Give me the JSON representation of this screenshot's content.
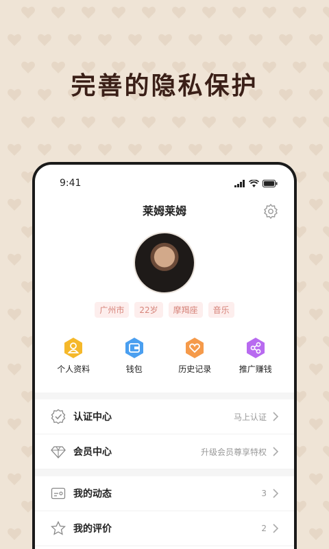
{
  "promo_title": "完善的隐私保护",
  "status_bar": {
    "time": "9:41"
  },
  "profile": {
    "name": "莱姆莱姆",
    "tags": [
      "广州市",
      "22岁",
      "摩羯座",
      "音乐"
    ]
  },
  "quick_actions": [
    {
      "label": "个人资料",
      "icon": "profile-icon",
      "color": "#f5b82a"
    },
    {
      "label": "钱包",
      "icon": "wallet-icon",
      "color": "#4a9ff0"
    },
    {
      "label": "历史记录",
      "icon": "history-icon",
      "color": "#f59a4a"
    },
    {
      "label": "推广赚钱",
      "icon": "share-icon",
      "color": "#b86af0"
    }
  ],
  "menu_group1": [
    {
      "label": "认证中心",
      "value": "马上认证",
      "icon": "verify-icon"
    },
    {
      "label": "会员中心",
      "value": "升级会员尊享特权",
      "icon": "diamond-icon"
    }
  ],
  "menu_group2": [
    {
      "label": "我的动态",
      "value": "3",
      "icon": "moments-icon"
    },
    {
      "label": "我的评价",
      "value": "2",
      "icon": "star-icon"
    }
  ],
  "colors": {
    "background": "#efe4d6",
    "title": "#3a1f17",
    "tag_text": "#d6847a",
    "tag_bg": "#fdeeed"
  }
}
